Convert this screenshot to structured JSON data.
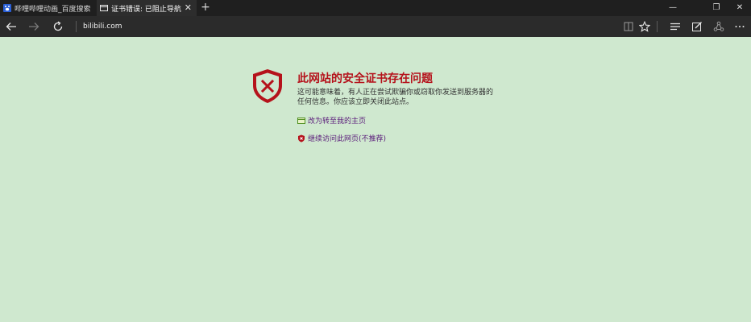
{
  "tabs": [
    {
      "label": "哔哩哔哩动画_百度搜索",
      "icon": "baidu-paw-icon",
      "active": false
    },
    {
      "label": "证书错误: 已阻止导航",
      "icon": "page-icon",
      "active": true
    }
  ],
  "tab_close_symbol": "✕",
  "new_tab_symbol": "+",
  "window_controls": {
    "minimize": "—",
    "restore": "❐",
    "close": "✕"
  },
  "address_bar": {
    "url": "bilibili.com"
  },
  "nav_icons": [
    "back-arrow-icon",
    "forward-arrow-icon",
    "refresh-icon",
    "reading-view-icon",
    "favorite-star-icon",
    "hub-icon",
    "web-note-icon",
    "share-icon",
    "more-icon"
  ],
  "error_page": {
    "title": "此网站的安全证书存在问题",
    "description": "这可能意味着，有人正在尝试欺骗你或窃取你发送到服务器的任何信息。你应该立即关闭此站点。",
    "links": [
      {
        "label": "改为转至我的主页",
        "icon": "home-page-icon"
      },
      {
        "label": "继续访问此网页(不推荐)",
        "icon": "shield-warning-icon"
      }
    ],
    "accent_color": "#b5121b",
    "background_color": "#cfe8cf"
  }
}
